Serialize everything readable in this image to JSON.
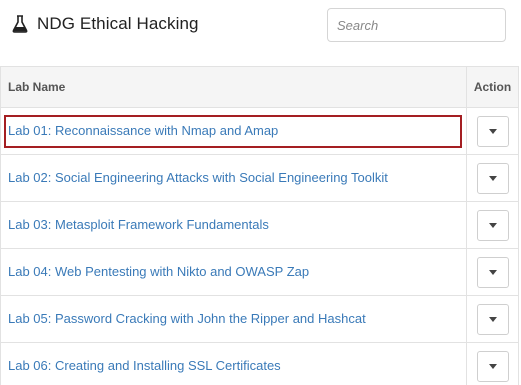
{
  "header": {
    "title": "NDG Ethical Hacking",
    "search_placeholder": "Search",
    "icon": "flask-icon"
  },
  "table": {
    "columns": [
      "Lab Name",
      "Action"
    ],
    "rows": [
      {
        "name": "Lab 01: Reconnaissance with Nmap and Amap",
        "selected": true
      },
      {
        "name": "Lab 02: Social Engineering Attacks with Social Engineering Toolkit",
        "selected": false
      },
      {
        "name": "Lab 03: Metasploit Framework Fundamentals",
        "selected": false
      },
      {
        "name": "Lab 04: Web Pentesting with Nikto and OWASP Zap",
        "selected": false
      },
      {
        "name": "Lab 05: Password Cracking with John the Ripper and Hashcat",
        "selected": false
      },
      {
        "name": "Lab 06: Creating and Installing SSL Certificates",
        "selected": false
      }
    ]
  },
  "colors": {
    "link": "#3a7ab8",
    "selection_border": "#a41e22",
    "header_bg": "#f5f5f5"
  }
}
